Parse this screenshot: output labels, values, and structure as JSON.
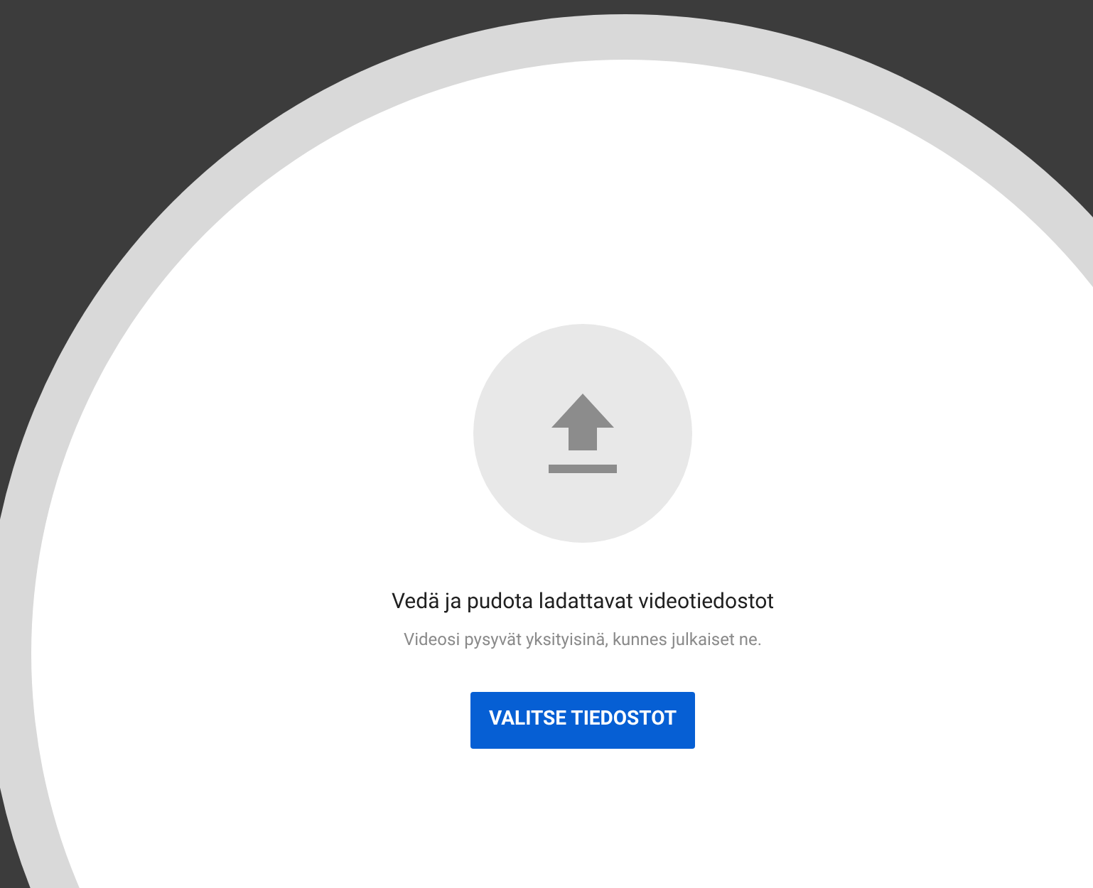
{
  "heading": "Vedä ja pudota ladattavat videotiedostot",
  "subtitle": "Videosi pysyvät yksityisinä, kunnes julkaiset ne.",
  "button": {
    "label": "VALITSE TIEDOSTOT"
  }
}
